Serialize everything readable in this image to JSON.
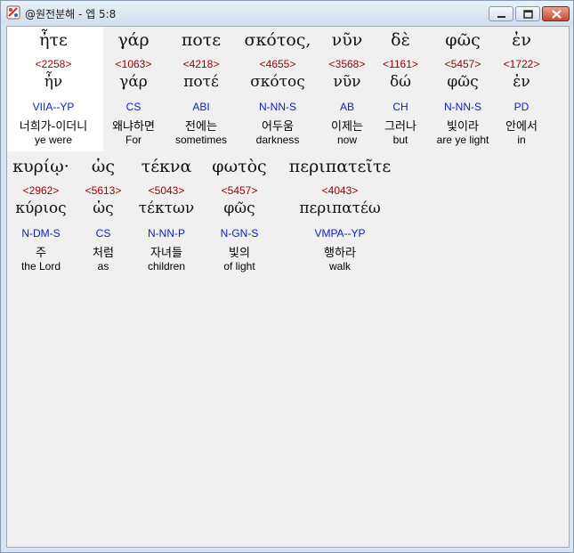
{
  "window": {
    "title": "@원전분해 - 엡 5:8"
  },
  "rows": [
    [
      {
        "greek": "ἦτε",
        "strong": "<2258>",
        "lemma": "ἦν",
        "parsing": "VIIA--YP",
        "korean": "너희가-이더니",
        "english": "ye were"
      },
      {
        "greek": "γάρ",
        "strong": "<1063>",
        "lemma": "γάρ",
        "parsing": "CS",
        "korean": "왜냐하면",
        "english": "For"
      },
      {
        "greek": "ποτε",
        "strong": "<4218>",
        "lemma": "ποτέ",
        "parsing": "ABI",
        "korean": "전에는",
        "english": "sometimes"
      },
      {
        "greek": "σκότος,",
        "strong": "<4655>",
        "lemma": "σκότος",
        "parsing": "N-NN-S",
        "korean": "어두움",
        "english": "darkness"
      },
      {
        "greek": "νῦν",
        "strong": "<3568>",
        "lemma": "νῦν",
        "parsing": "AB",
        "korean": "이제는",
        "english": "now"
      },
      {
        "greek": "δὲ",
        "strong": "<1161>",
        "lemma": "δώ",
        "parsing": "CH",
        "korean": "그러나",
        "english": "but"
      },
      {
        "greek": "φῶς",
        "strong": "<5457>",
        "lemma": "φῶς",
        "parsing": "N-NN-S",
        "korean": "빛이라",
        "english": "are ye light"
      },
      {
        "greek": "ἐν",
        "strong": "<1722>",
        "lemma": "ἐν",
        "parsing": "PD",
        "korean": "안에서",
        "english": "in"
      }
    ],
    [
      {
        "greek": "κυρίῳ·",
        "strong": "<2962>",
        "lemma": "κύριος",
        "parsing": "N-DM-S",
        "korean": "주",
        "english": "the Lord"
      },
      {
        "greek": "ὡς",
        "strong": "<5613>",
        "lemma": "ὡς",
        "parsing": "CS",
        "korean": "처럼",
        "english": "as"
      },
      {
        "greek": "τέκνα",
        "strong": "<5043>",
        "lemma": "τέκτων",
        "parsing": "N-NN-P",
        "korean": "자녀들",
        "english": "children"
      },
      {
        "greek": "φωτὸς",
        "strong": "<5457>",
        "lemma": "φῶς",
        "parsing": "N-GN-S",
        "korean": "빛의",
        "english": "of light"
      },
      {
        "greek": "περιπατεῖτε",
        "strong": "<4043>",
        "lemma": "περιπατέω",
        "parsing": "VMPA--YP",
        "korean": "행하라",
        "english": "walk"
      }
    ]
  ]
}
